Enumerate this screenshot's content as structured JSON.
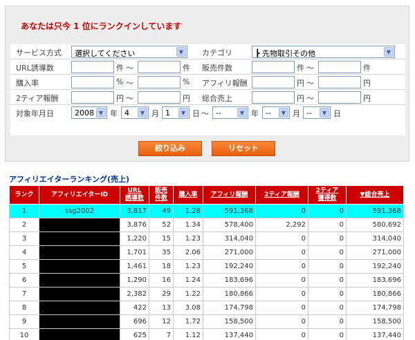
{
  "notice": "あなたは只今 1 位にランクインしています",
  "filters": {
    "service_label": "サービス方式",
    "service_value": "選択してください",
    "category_label": "カテゴリ",
    "category_value": "┣ 先物取引その他",
    "url_label": "URL誘導数",
    "sales_count_label": "販売件数",
    "purchase_rate_label": "購入率",
    "affiliate_reward_label": "アフィリ報酬",
    "tier2_label": "2ティア報酬",
    "total_sales_label": "総合売上",
    "date_label": "対象年月日",
    "unit_ken": "件",
    "unit_percent": "%",
    "unit_yen": "円",
    "tilde": "～",
    "year_value": "2008",
    "year_unit": "年",
    "month_value": "4",
    "month_unit": "月",
    "day_value": "1",
    "day_unit": "日",
    "empty_value": "--"
  },
  "buttons": {
    "filter": "絞り込み",
    "reset": "リセット"
  },
  "ranking": {
    "title": "アフィリエイターランキング(売上)",
    "headers": {
      "rank": "ランク",
      "affiliate_id": "アフィリエイターID",
      "url_line1": "URL",
      "url_line2": "誘導数",
      "sales_line1": "販売",
      "sales_line2": "件数",
      "purchase_rate": "購入率",
      "affiliate_reward": "アフィリ報酬",
      "tier2_reward": "2ティア報酬",
      "tier2_line1": "2ティア",
      "tier2_line2": "獲得数",
      "total_sales": "▼総合売上"
    },
    "rows": [
      {
        "rank": "1",
        "id": "ssg2002",
        "url": "3,817",
        "sales": "49",
        "rate": "1.28",
        "reward": "591,368",
        "tier2": "0",
        "tier2count": "0",
        "total": "591,368"
      },
      {
        "rank": "2",
        "id": "",
        "url": "3,876",
        "sales": "52",
        "rate": "1.34",
        "reward": "578,400",
        "tier2": "2,292",
        "tier2count": "0",
        "total": "580,692"
      },
      {
        "rank": "3",
        "id": "",
        "url": "1,220",
        "sales": "15",
        "rate": "1.23",
        "reward": "314,040",
        "tier2": "0",
        "tier2count": "0",
        "total": "314,040"
      },
      {
        "rank": "4",
        "id": "",
        "url": "1,701",
        "sales": "35",
        "rate": "2.06",
        "reward": "271,000",
        "tier2": "0",
        "tier2count": "0",
        "total": "271,000"
      },
      {
        "rank": "5",
        "id": "",
        "url": "1,461",
        "sales": "18",
        "rate": "1.23",
        "reward": "192,240",
        "tier2": "0",
        "tier2count": "0",
        "total": "192,240"
      },
      {
        "rank": "6",
        "id": "",
        "url": "1,290",
        "sales": "16",
        "rate": "1.24",
        "reward": "183,696",
        "tier2": "0",
        "tier2count": "0",
        "total": "183,696"
      },
      {
        "rank": "7",
        "id": "",
        "url": "2,382",
        "sales": "29",
        "rate": "1.22",
        "reward": "180,866",
        "tier2": "0",
        "tier2count": "0",
        "total": "180,866"
      },
      {
        "rank": "8",
        "id": "",
        "url": "422",
        "sales": "13",
        "rate": "3.08",
        "reward": "174,798",
        "tier2": "0",
        "tier2count": "0",
        "total": "174,798"
      },
      {
        "rank": "9",
        "id": "",
        "url": "696",
        "sales": "12",
        "rate": "1.72",
        "reward": "158,500",
        "tier2": "0",
        "tier2count": "0",
        "total": "158,500"
      },
      {
        "rank": "10",
        "id": "",
        "url": "625",
        "sales": "7",
        "rate": "1.12",
        "reward": "137,440",
        "tier2": "0",
        "tier2count": "0",
        "total": "137,440"
      }
    ]
  },
  "colors": {
    "accent_red": "#cc0000",
    "button_orange": "#f26d1c",
    "highlight_cyan": "#00ffff",
    "title_blue": "#003399"
  }
}
